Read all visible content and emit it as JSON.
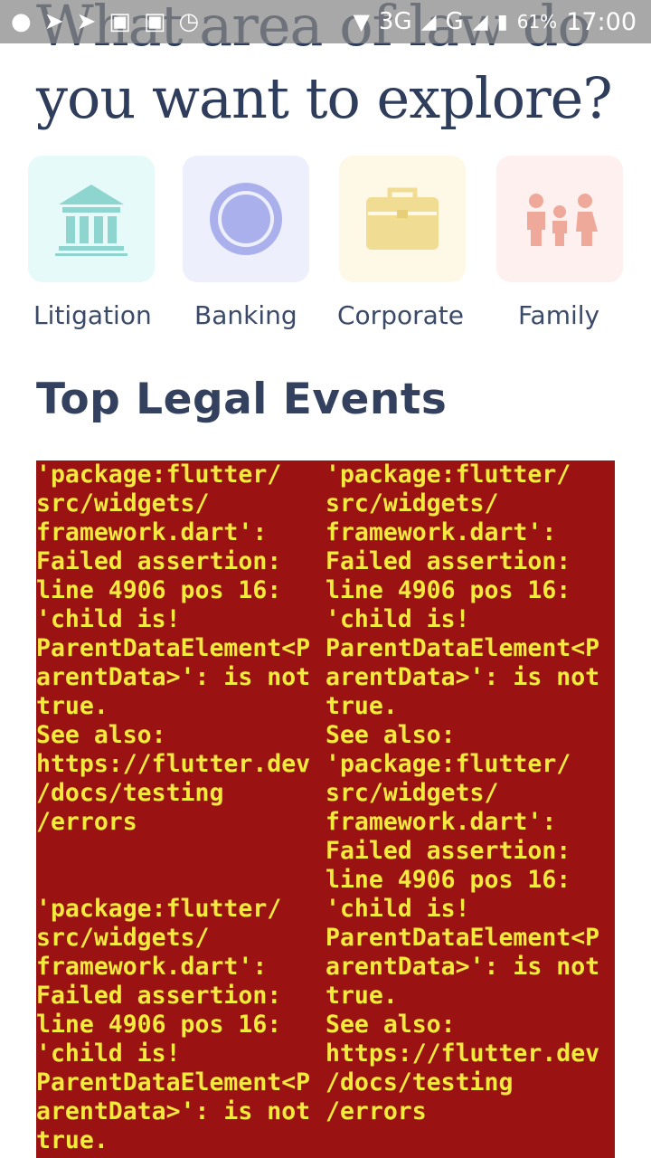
{
  "heading": {
    "line1": "What area of law do",
    "line2": "you want to explore?"
  },
  "status_bar": {
    "notification_icons": [
      "chat-bubble-icon",
      "telegram-icon",
      "telegram-icon",
      "cart-icon",
      "cart-icon",
      "alarm-icon"
    ],
    "network": "3G",
    "second_network": "G",
    "battery": "61%",
    "time": "17:00"
  },
  "categories": [
    {
      "label": "Litigation",
      "icon": "courthouse-icon",
      "tile_color": "#e6fbf9",
      "icon_color": "#8fd5cf"
    },
    {
      "label": "Banking",
      "icon": "coin-icon",
      "tile_color": "#eeeffd",
      "icon_color": "#aab0ec"
    },
    {
      "label": "Corporate",
      "icon": "briefcase-icon",
      "tile_color": "#fef9e6",
      "icon_color": "#f0dc92"
    },
    {
      "label": "Family",
      "icon": "family-icon",
      "tile_color": "#fdf0ef",
      "icon_color": "#efa99a"
    }
  ],
  "section_title": "Top Legal Events",
  "error": {
    "colors": {
      "background": "#9b1212",
      "text": "#f3ea3d"
    },
    "column_left": "'package:flutter/\nsrc/widgets/\nframework.dart':\nFailed assertion:\nline 4906 pos 16:\n'child is!\nParentDataElement<P\narentData>': is not\ntrue.\nSee also:\nhttps://flutter.dev\n/docs/testing\n/errors\n\n\n'package:flutter/\nsrc/widgets/\nframework.dart':\nFailed assertion:\nline 4906 pos 16:\n'child is!\nParentDataElement<P\narentData>': is not\ntrue.",
    "column_right": "'package:flutter/\nsrc/widgets/\nframework.dart':\nFailed assertion:\nline 4906 pos 16:\n'child is!\nParentDataElement<P\narentData>': is not\ntrue.\nSee also:\n'package:flutter/\nsrc/widgets/\nframework.dart':\nFailed assertion:\nline 4906 pos 16:\n'child is!\nParentDataElement<P\narentData>': is not\ntrue.\nSee also:\nhttps://flutter.dev\n/docs/testing\n/errors"
  }
}
